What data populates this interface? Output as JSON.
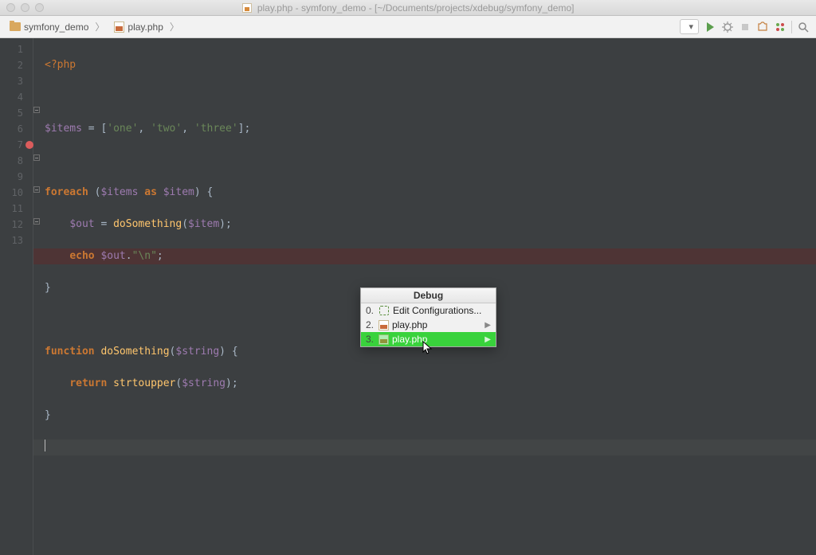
{
  "title": "play.php - symfony_demo - [~/Documents/projects/xdebug/symfony_demo]",
  "breadcrumbs": [
    {
      "label": "symfony_demo",
      "type": "folder"
    },
    {
      "label": "play.php",
      "type": "php"
    }
  ],
  "toolbar_config_placeholder": " ",
  "gutter": [
    "1",
    "2",
    "3",
    "4",
    "5",
    "6",
    "7",
    "8",
    "9",
    "10",
    "11",
    "12",
    "13"
  ],
  "breakpoint_line": 7,
  "code": {
    "l1_open": "<?php",
    "l3_var": "$items",
    "l3_eq": " = [",
    "l3_s1": "'one'",
    "l3_c1": ", ",
    "l3_s2": "'two'",
    "l3_c2": ", ",
    "l3_s3": "'three'",
    "l3_end": "];",
    "l5_kw": "foreach ",
    "l5_p1": "(",
    "l5_v1": "$items ",
    "l5_as": "as ",
    "l5_v2": "$item",
    "l5_p2": ") {",
    "l6_v": "$out",
    "l6_eq": " = ",
    "l6_fn": "doSomething",
    "l6_p1": "(",
    "l6_vv": "$item",
    "l6_p2": ");",
    "l7_kw": "echo ",
    "l7_v": "$out",
    "l7_dot": ".",
    "l7_s": "\"\\n\"",
    "l7_end": ";",
    "l8_close": "}",
    "l10_kw": "function ",
    "l10_fn": "doSomething",
    "l10_p1": "(",
    "l10_v": "$string",
    "l10_p2": ") {",
    "l11_kw": "return ",
    "l11_fn": "strtoupper",
    "l11_p1": "(",
    "l11_v": "$string",
    "l11_p2": ");",
    "l12_close": "}"
  },
  "popup": {
    "title": "Debug",
    "items": [
      {
        "num": "0.",
        "label": "Edit Configurations...",
        "icon": "cfg",
        "submenu": false
      },
      {
        "num": "2.",
        "label": "play.php",
        "icon": "php",
        "submenu": true
      },
      {
        "num": "3.",
        "label": "play.php",
        "icon": "php",
        "submenu": true,
        "selected": true
      }
    ]
  }
}
